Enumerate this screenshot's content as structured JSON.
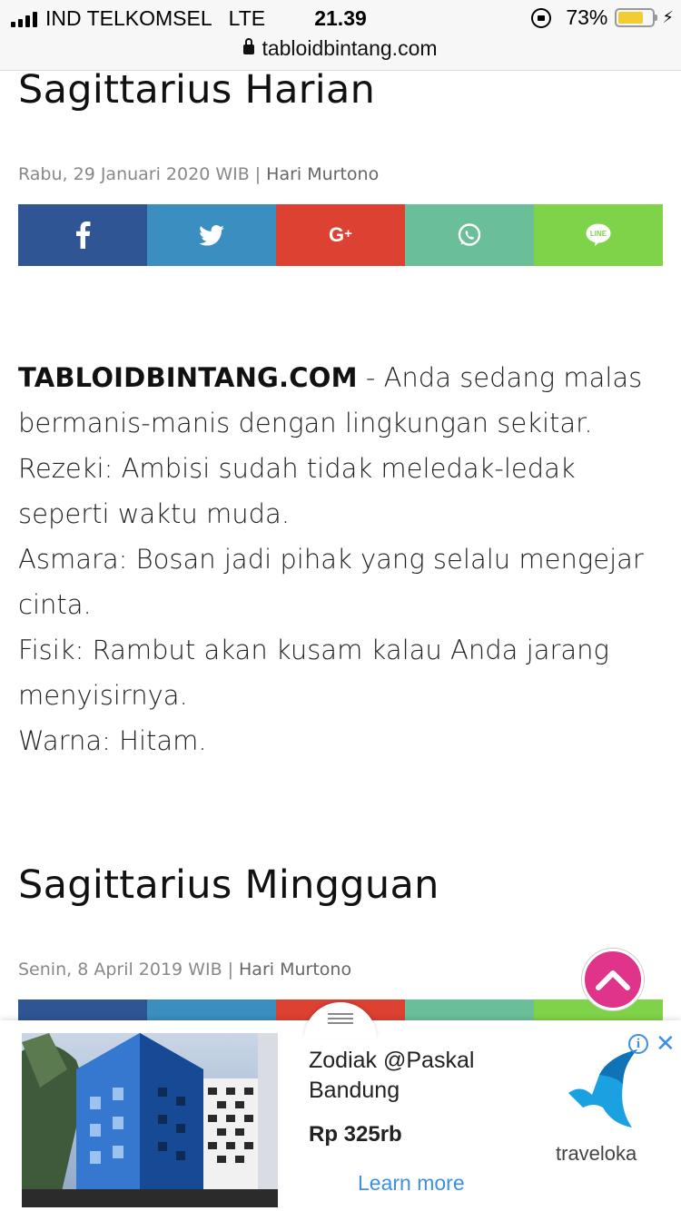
{
  "status_bar": {
    "carrier": "IND TELKOMSEL",
    "network": "LTE",
    "time": "21.39",
    "battery_percent": "73%",
    "battery_level": 0.73,
    "battery_color": "#f3cc33"
  },
  "browser": {
    "url": "tabloidbintang.com"
  },
  "article_daily": {
    "title": "Sagittarius Harian",
    "date": "Rabu, 29 Januari 2020 WIB",
    "separator": "|",
    "author": "Hari Murtono",
    "share_buttons": [
      {
        "name": "facebook",
        "icon": "f",
        "color": "#2f5595"
      },
      {
        "name": "twitter",
        "icon": "twitter-bird",
        "color": "#3b8fc0"
      },
      {
        "name": "google-plus",
        "icon": "G+",
        "color": "#dd4132"
      },
      {
        "name": "whatsapp",
        "icon": "whatsapp",
        "color": "#6bbf98"
      },
      {
        "name": "line",
        "icon": "LINE",
        "color": "#7fd349"
      }
    ],
    "brand": "TABLOIDBINTANG.COM",
    "intro": " - Anda sedang malas bermanis-manis dengan lingkungan sekitar.",
    "paragraphs": [
      "Rezeki: Ambisi sudah tidak meledak-ledak seperti waktu muda.",
      "Asmara: Bosan jadi pihak yang selalu mengejar cinta.",
      "Fisik: Rambut akan kusam kalau Anda jarang menyisirnya.",
      "Warna: Hitam."
    ]
  },
  "article_weekly": {
    "title": "Sagittarius Mingguan",
    "date": "Senin, 8 April 2019 WIB",
    "separator": "|",
    "author": "Hari Murtono"
  },
  "scroll_top": {
    "icon": "chevron-up-icon",
    "color": "#e0338a"
  },
  "ad": {
    "title": "Zodiak @Paskal Bandung",
    "price": "Rp 325rb",
    "cta": "Learn more",
    "brand": "traveloka",
    "info_glyph": "i",
    "close_glyph": "✕"
  }
}
